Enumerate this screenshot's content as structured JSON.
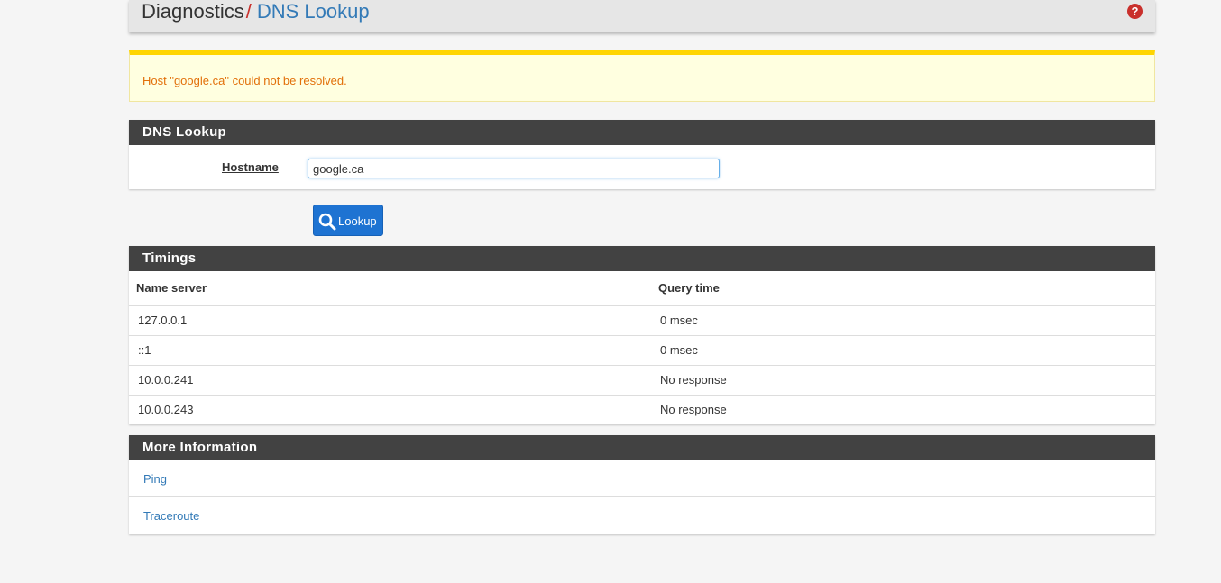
{
  "breadcrumb": {
    "parent": "Diagnostics",
    "separator": "/",
    "current": "DNS Lookup"
  },
  "help_icon_glyph": "?",
  "alert": {
    "message": "Host \"google.ca\" could not be resolved.",
    "color": "#e2700a"
  },
  "dns_panel": {
    "title": "DNS Lookup",
    "hostname_label": "Hostname",
    "hostname_value": "google.ca"
  },
  "lookup_button": {
    "label": "Lookup",
    "icon": "search-icon",
    "color": "#1e73d2"
  },
  "timings": {
    "title": "Timings",
    "columns": [
      "Name server",
      "Query time"
    ],
    "rows": [
      {
        "server": "127.0.0.1",
        "time": "0 msec"
      },
      {
        "server": "::1",
        "time": "0 msec"
      },
      {
        "server": "10.0.0.241",
        "time": "No response"
      },
      {
        "server": "10.0.0.243",
        "time": "No response"
      }
    ]
  },
  "more_info": {
    "title": "More Information",
    "links": [
      "Ping",
      "Traceroute"
    ]
  }
}
